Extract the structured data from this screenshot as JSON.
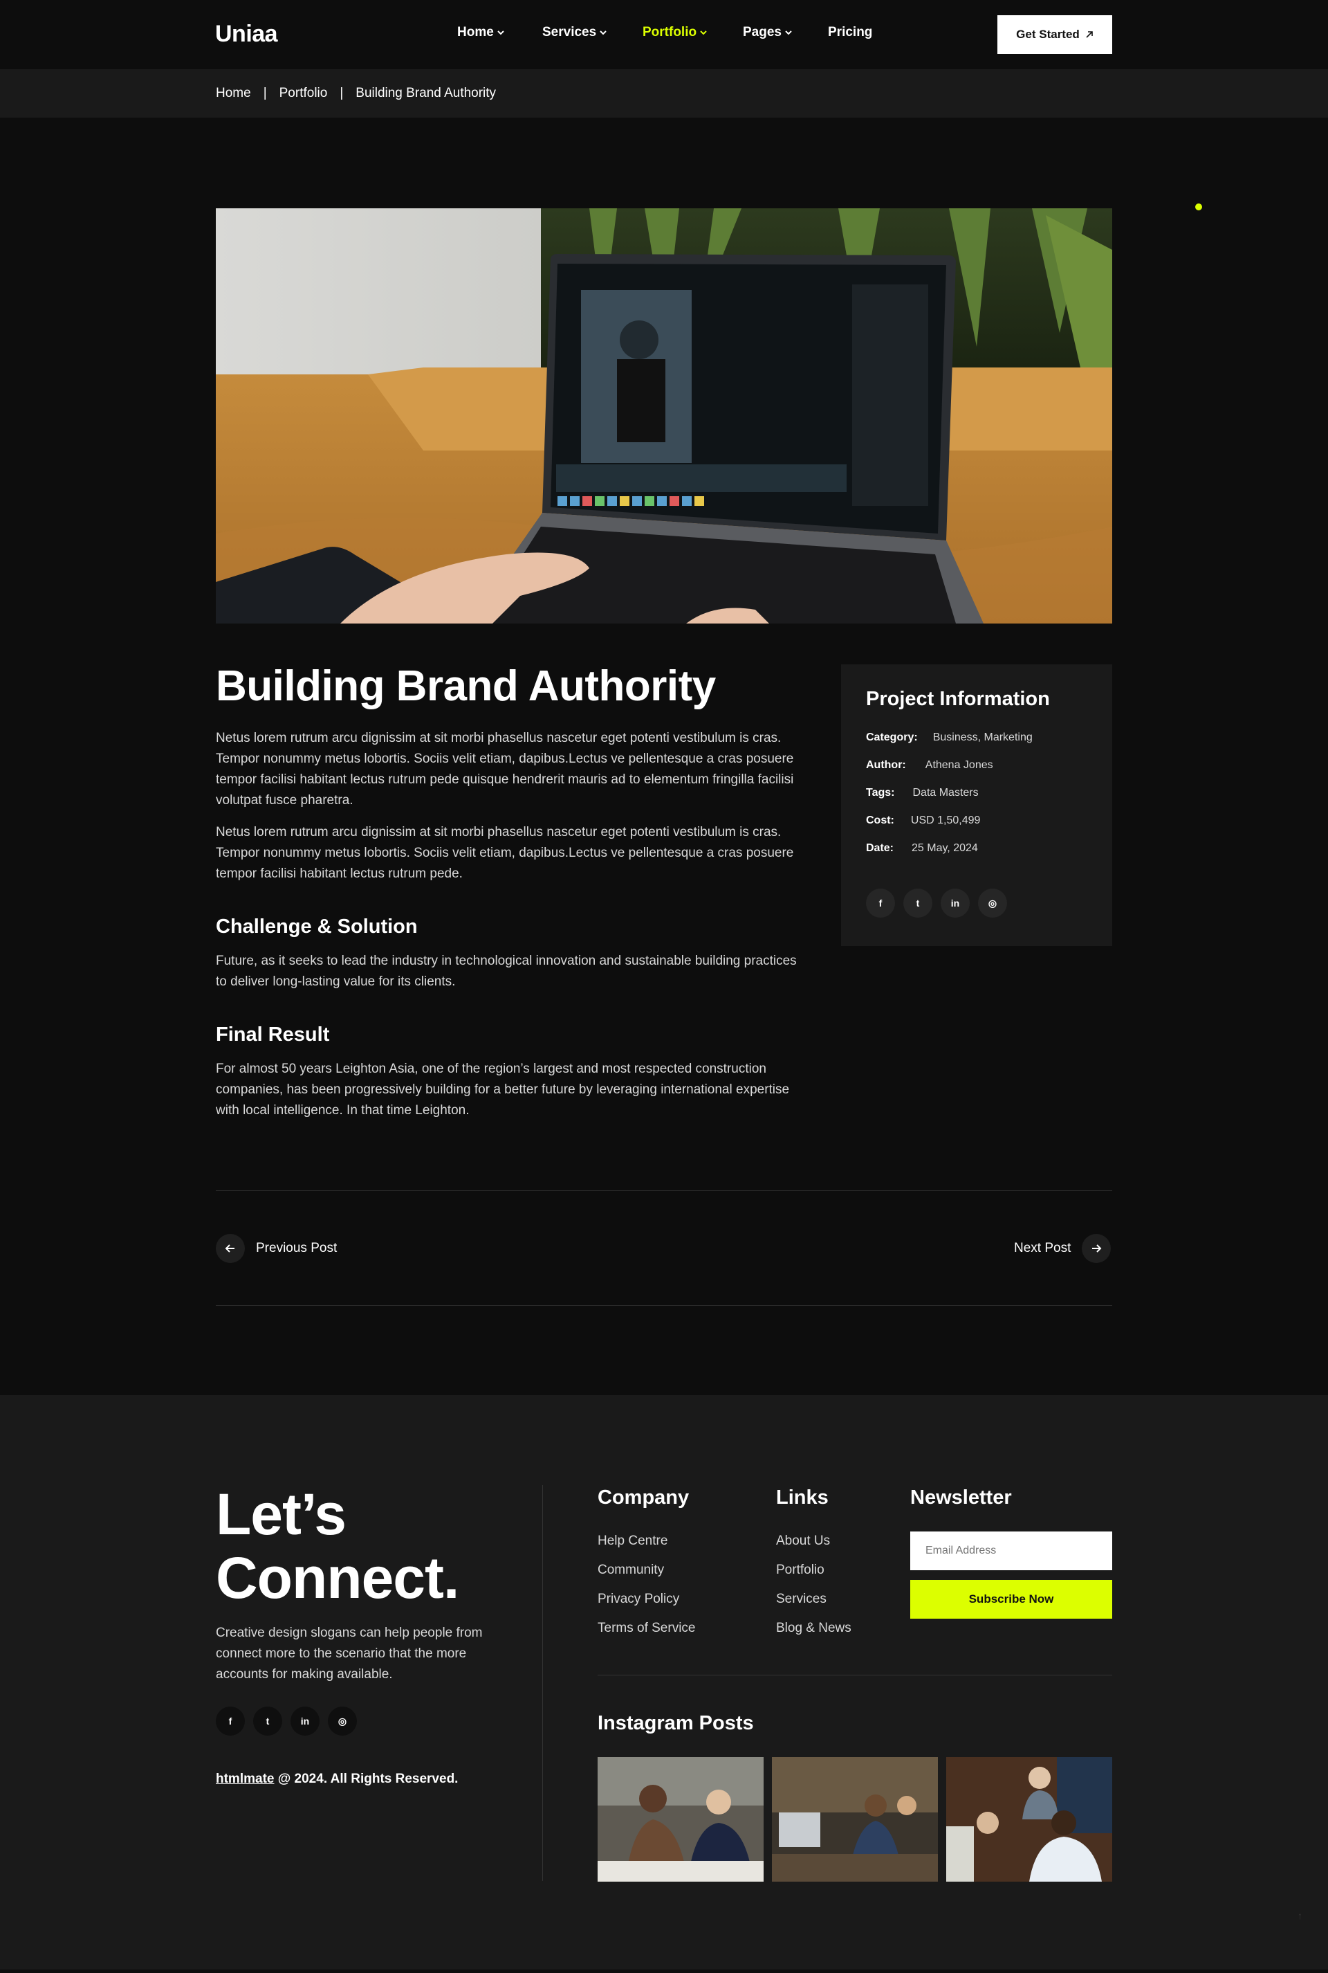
{
  "brand": {
    "logo": "Uniaa",
    "accent": "#dcff00"
  },
  "nav": {
    "items": [
      {
        "label": "Home",
        "dropdown": true
      },
      {
        "label": "Services",
        "dropdown": true
      },
      {
        "label": "Portfolio",
        "dropdown": true,
        "active": true
      },
      {
        "label": "Pages",
        "dropdown": true
      },
      {
        "label": "Pricing",
        "dropdown": false
      }
    ],
    "cta_label": "Get Started",
    "cta_icon": "arrow-up-right-icon"
  },
  "breadcrumb": {
    "items": [
      "Home",
      "Portfolio",
      "Building Brand Authority"
    ],
    "separator": "|"
  },
  "hero": {
    "image": "laptop-photo-editing"
  },
  "article": {
    "title": "Building Brand Authority",
    "paragraphs": [
      "Netus lorem rutrum arcu dignissim at sit morbi phasellus nascetur eget potenti vestibulum is cras. Tempor nonummy metus lobortis. Sociis velit etiam, dapibus.Lectus ve pellentesque a cras posuere tempor facilisi habitant lectus rutrum pede quisque hendrerit mauris ad to elementum fringilla facilisi volutpat fusce pharetra.",
      "Netus lorem rutrum arcu dignissim at sit morbi phasellus nascetur eget potenti vestibulum is cras. Tempor nonummy metus lobortis. Sociis velit etiam, dapibus.Lectus ve pellentesque a cras posuere tempor facilisi habitant lectus rutrum pede."
    ],
    "challenge": {
      "heading": "Challenge & Solution",
      "text": "Future, as it seeks to lead the industry in technological innovation and sustainable building practices to deliver long-lasting value for its clients."
    },
    "result": {
      "heading": "Final Result",
      "text": "For almost 50 years Leighton Asia, one of the region’s largest and most respected construction companies, has been progressively building for a better future by leveraging international expertise with local intelligence. In that time Leighton."
    }
  },
  "project_info": {
    "heading": "Project Information",
    "rows": [
      {
        "key": "Category:",
        "value": "Business,  Marketing"
      },
      {
        "key": "Author:",
        "value": "Athena Jones"
      },
      {
        "key": "Tags:",
        "value": "Data Masters"
      },
      {
        "key": "Cost:",
        "value": "USD 1,50,499"
      },
      {
        "key": "Date:",
        "value": "25 May, 2024"
      }
    ],
    "social": [
      {
        "icon": "facebook-icon",
        "glyph": "f"
      },
      {
        "icon": "twitter-icon",
        "glyph": "t"
      },
      {
        "icon": "linkedin-icon",
        "glyph": "in"
      },
      {
        "icon": "instagram-icon",
        "glyph": "◎"
      }
    ]
  },
  "post_nav": {
    "prev": "Previous Post",
    "next": "Next Post"
  },
  "footer": {
    "connect_line1": "Let’s",
    "connect_line2": "Connect.",
    "text": "Creative design slogans can help people from connect more to the scenario that the more accounts for making available.",
    "copyright_link": "htmlmate",
    "copyright_rest": " @ 2024. All Rights Reserved.",
    "company": {
      "heading": "Company",
      "links": [
        "Help Centre",
        "Community",
        "Privacy Policy",
        "Terms of Service"
      ]
    },
    "links": {
      "heading": "Links",
      "links": [
        "About Us",
        "Portfolio",
        "Services",
        "Blog & News"
      ]
    },
    "newsletter": {
      "heading": "Newsletter",
      "placeholder": "Email Address",
      "button": "Subscribe Now"
    },
    "instagram": {
      "heading": "Instagram Posts"
    }
  }
}
